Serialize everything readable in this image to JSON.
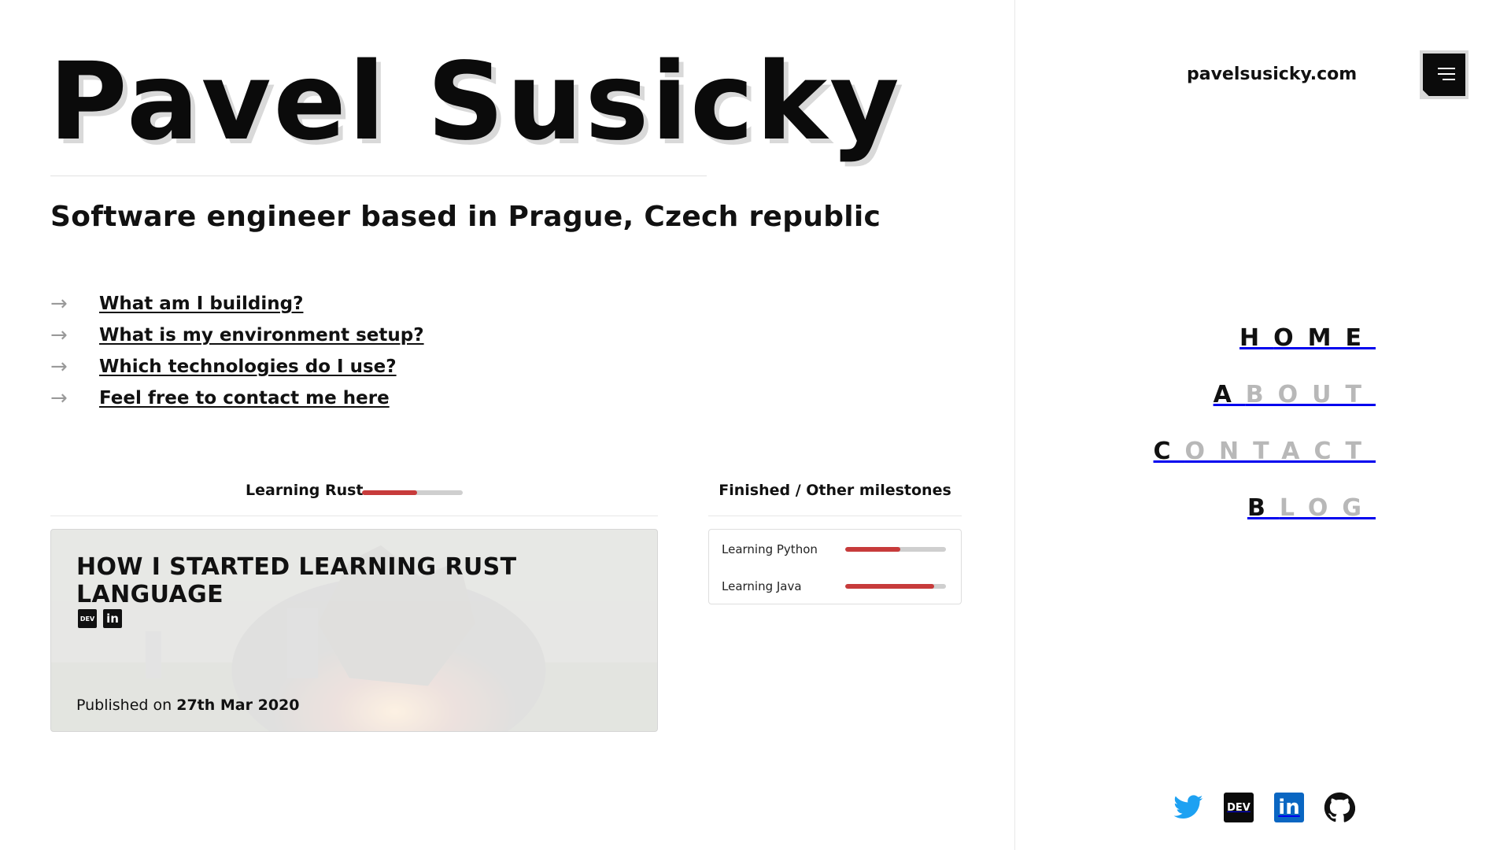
{
  "header": {
    "name": "Pavel Susicky",
    "tagline": "Software engineer based in Prague, Czech republic"
  },
  "links": [
    {
      "label": "What am I building?"
    },
    {
      "label": "What is my environment setup?"
    },
    {
      "label": "Which technologies do I use?"
    },
    {
      "label": "Feel free to contact me here"
    }
  ],
  "link_arrow": "→",
  "current": {
    "label": "Learning Rust",
    "progress": 0.55
  },
  "post": {
    "title": "HOW I STARTED LEARNING RUST LANGUAGE",
    "published_prefix": "Published on",
    "published_date": "27th Mar 2020",
    "icons": [
      "dev-icon",
      "linkedin-icon"
    ]
  },
  "milestones": {
    "title": "Finished / Other milestones",
    "items": [
      {
        "label": "Learning Python",
        "progress": 0.55
      },
      {
        "label": "Learning Java",
        "progress": 0.88
      }
    ]
  },
  "site": {
    "domain": "pavelsusicky.com"
  },
  "nav": [
    {
      "first": "H",
      "rest": "OME",
      "active": true
    },
    {
      "first": "A",
      "rest": "BOUT",
      "active": false
    },
    {
      "first": "C",
      "rest": "ONTACT",
      "active": false
    },
    {
      "first": "B",
      "rest": "LOG",
      "active": false
    }
  ],
  "socials": {
    "twitter_icon": "twitter-icon",
    "dev_label": "DEV",
    "linkedin_label": "in",
    "github_icon": "github-icon"
  },
  "colors": {
    "accent_red": "#c73b3b",
    "twitter_blue": "#1da1f2",
    "linkedin_blue": "#0a66c2",
    "inactive_nav": "#b8b8b8"
  }
}
